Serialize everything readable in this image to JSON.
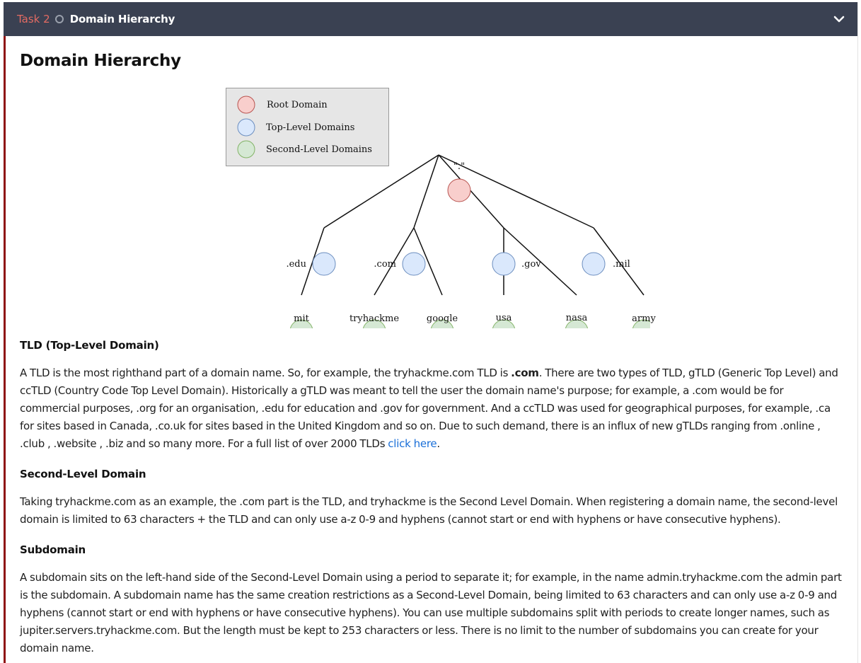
{
  "header": {
    "task_number": "Task 2",
    "title": "Domain Hierarchy"
  },
  "page_title": "Domain Hierarchy",
  "diagram": {
    "legend": {
      "root": "Root Domain",
      "tld": "Top-Level Domains",
      "sld": "Second-Level Domains"
    },
    "root_label": "\".\"",
    "tlds": [
      ".edu",
      ".com",
      ".gov",
      ".mil"
    ],
    "slds": [
      "mit",
      "tryhackme",
      "google",
      "usa",
      "nasa",
      "army"
    ],
    "colors": {
      "root_fill": "#f8cecc",
      "root_stroke": "#b85450",
      "tld_fill": "#dae8fc",
      "tld_stroke": "#6c8ebf",
      "sld_fill": "#d5e8d4",
      "sld_stroke": "#82b366",
      "legend_bg": "#e6e6e6"
    }
  },
  "sections": {
    "tld": {
      "heading": "TLD (Top-Level Domain)",
      "p_before_bold": "A TLD is the most righthand part of a domain name. So, for example, the tryhackme.com TLD is ",
      "p_bold": ".com",
      "p_after_bold": ". There are two types of TLD, gTLD (Generic Top Level) and ccTLD (Country Code Top Level Domain). Historically a gTLD was meant to tell the user the domain name's purpose; for example, a .com would be for commercial purposes, .org for an organisation, .edu for education and .gov for government. And a ccTLD was used for geographical purposes, for example, .ca for sites based in Canada, .co.uk for sites based in the United Kingdom and so on. Due to such demand, there is an influx of new gTLDs ranging from .online , .club , .website , .biz and so many more. For a full list of over 2000 TLDs ",
      "link": "click here",
      "p_end": "."
    },
    "sld": {
      "heading": "Second-Level Domain",
      "text": "Taking tryhackme.com as an example, the .com part is the TLD, and tryhackme is the Second Level Domain. When registering a domain name, the second-level domain is limited to 63 characters + the TLD and can only use a-z 0-9 and hyphens (cannot start or end with hyphens or have consecutive hyphens)."
    },
    "subdomain": {
      "heading": "Subdomain",
      "text": "A subdomain sits on the left-hand side of the Second-Level Domain using a period to separate it; for example, in the name admin.tryhackme.com the admin part is the subdomain. A subdomain name has the same creation restrictions as a Second-Level Domain, being limited to 63 characters and can only use a-z 0-9 and hyphens (cannot start or end with hyphens or have consecutive hyphens). You can use multiple subdomains split with periods to create longer names, such as jupiter.servers.tryhackme.com. But the length must be kept to 253 characters or less. There is no limit to the number of subdomains you can create for your domain name."
    }
  }
}
